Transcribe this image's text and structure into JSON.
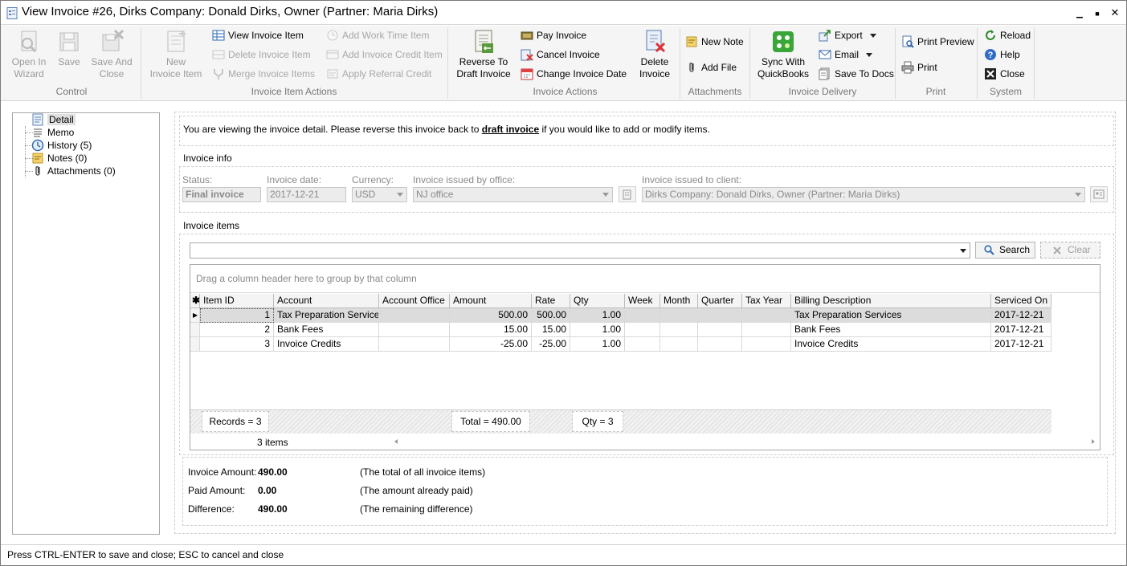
{
  "window": {
    "title": "View Invoice #26, Dirks Company: Donald Dirks, Owner (Partner: Maria Dirks)",
    "minimize": "▁",
    "maximize": "■",
    "close": "✕"
  },
  "ribbon": {
    "control": {
      "label": "Control",
      "open_in_wizard": "Open In\nWizard",
      "save": "Save",
      "save_and_close": "Save And\nClose"
    },
    "item_actions": {
      "label": "Invoice Item Actions",
      "new_invoice_item": "New\nInvoice Item",
      "view_invoice_item": "View Invoice Item",
      "delete_invoice_item": "Delete Invoice Item",
      "merge_invoice_items": "Merge Invoice Items",
      "add_work_time_item": "Add Work Time Item",
      "add_invoice_credit_item": "Add Invoice Credit Item",
      "apply_referral_credit": "Apply Referral Credit"
    },
    "invoice_actions": {
      "label": "Invoice Actions",
      "reverse_to_draft": "Reverse To\nDraft Invoice",
      "pay_invoice": "Pay Invoice",
      "cancel_invoice": "Cancel Invoice",
      "change_invoice_date": "Change Invoice Date",
      "delete_invoice": "Delete\nInvoice"
    },
    "attachments": {
      "label": "Attachments",
      "new_note": "New Note",
      "add_file": "Add File"
    },
    "delivery": {
      "label": "Invoice Delivery",
      "sync_quickbooks": "Sync With\nQuickBooks",
      "export": "Export",
      "email": "Email",
      "save_to_docs": "Save To Docs"
    },
    "print": {
      "label": "Print",
      "print_preview": "Print Preview",
      "print": "Print"
    },
    "system": {
      "label": "System",
      "reload": "Reload",
      "help": "Help",
      "close": "Close"
    }
  },
  "nav": {
    "items": [
      {
        "label": "Detail"
      },
      {
        "label": "Memo"
      },
      {
        "label": "History (5)"
      },
      {
        "label": "Notes (0)"
      },
      {
        "label": "Attachments (0)"
      }
    ]
  },
  "notice": {
    "before": "You are viewing the invoice detail. Please reverse this invoice back to ",
    "link": "draft invoice",
    "after": " if you would like to add or modify items."
  },
  "invoice_info": {
    "section_label": "Invoice info",
    "status_label": "Status:",
    "status_value": "Final invoice",
    "date_label": "Invoice date:",
    "date_value": "2017-12-21",
    "currency_label": "Currency:",
    "currency_value": "USD",
    "office_label": "Invoice issued by office:",
    "office_value": "NJ office",
    "client_label": "Invoice issued to client:",
    "client_value": "Dirks Company: Donald Dirks, Owner (Partner: Maria Dirks)"
  },
  "invoice_items": {
    "section_label": "Invoice items",
    "search_value": "",
    "search_button": "Search",
    "clear_button": "Clear",
    "group_hint": "Drag a column header here to group by that column",
    "columns": [
      "Item ID",
      "Account",
      "Account Office",
      "Amount",
      "Rate",
      "Qty",
      "Week",
      "Month",
      "Quarter",
      "Tax Year",
      "Billing Description",
      "Serviced On"
    ],
    "rows": [
      [
        "1",
        "Tax Preparation Services",
        "",
        "500.00",
        "500.00",
        "1.00",
        "",
        "",
        "",
        "",
        "Tax Preparation Services",
        "2017-12-21"
      ],
      [
        "2",
        "Bank Fees",
        "",
        "15.00",
        "15.00",
        "1.00",
        "",
        "",
        "",
        "",
        "Bank Fees",
        "2017-12-21"
      ],
      [
        "3",
        "Invoice Credits",
        "",
        "-25.00",
        "-25.00",
        "1.00",
        "",
        "",
        "",
        "",
        "Invoice Credits",
        "2017-12-21"
      ]
    ],
    "footer_records": "Records = 3",
    "footer_total": "Total = 490.00",
    "footer_qty": "Qty = 3",
    "items_count": "3 items"
  },
  "summary": {
    "invoice_amount_label": "Invoice Amount:",
    "invoice_amount_value": "490.00",
    "invoice_amount_note": "(The total of all invoice items)",
    "paid_amount_label": "Paid Amount:",
    "paid_amount_value": "0.00",
    "paid_amount_note": "(The amount already paid)",
    "difference_label": "Difference:",
    "difference_value": "490.00",
    "difference_note": "(The remaining difference)"
  },
  "status_bar": {
    "text": "Press CTRL-ENTER to save and close; ESC to cancel and close"
  }
}
